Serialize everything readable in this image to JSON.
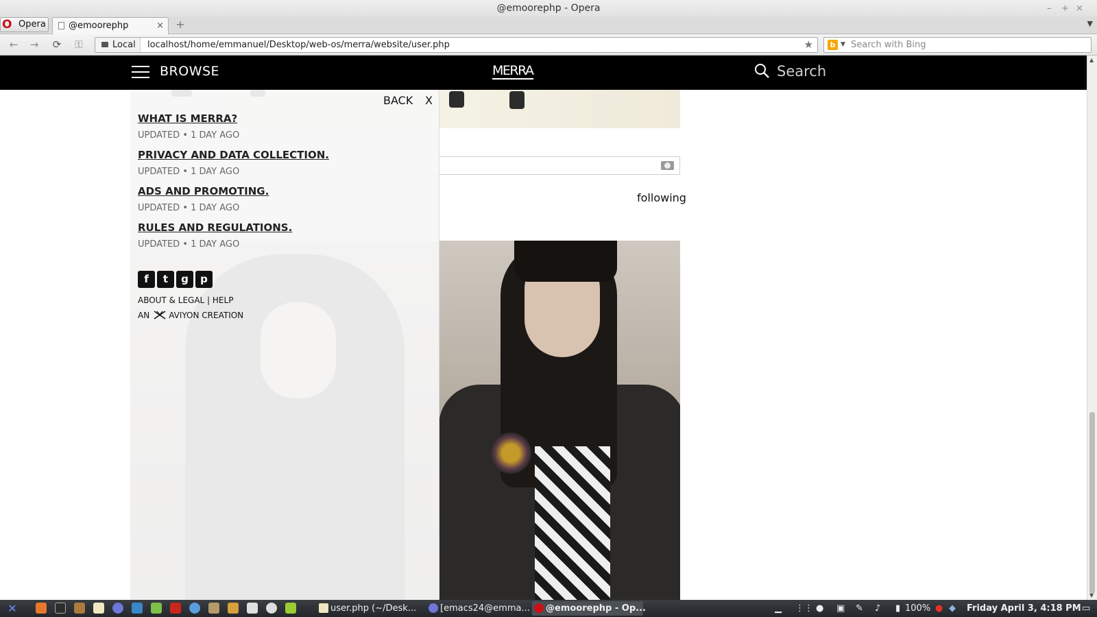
{
  "window": {
    "title": "@emoorephp - Opera",
    "controls": [
      "–",
      "+",
      "×"
    ]
  },
  "browser": {
    "menu_button": "Opera",
    "tab_title": "@emoorephp",
    "tab_close": "×",
    "new_tab": "+",
    "nav_buttons": {
      "back": "←",
      "forward": "→",
      "reload": "⟳",
      "key": "⚿"
    },
    "security_badge": "Local",
    "url": "localhost/home/emmanuel/Desktop/web-os/merra/website/user.php",
    "bookmark_star": "★",
    "search_placeholder": "Search with Bing"
  },
  "site": {
    "header": {
      "browse_label": "BROWSE",
      "logo_text": "MERRA",
      "search_label": "Search"
    },
    "feed": {
      "following_label": "following"
    },
    "menu": {
      "back_label": "BACK",
      "close_label": "X",
      "items": [
        {
          "title": "WHAT IS MERRA?",
          "meta": "UPDATED • 1 DAY AGO"
        },
        {
          "title": "PRIVACY AND DATA COLLECTION.",
          "meta": "UPDATED • 1 DAY AGO"
        },
        {
          "title": "ADS AND PROMOTING.",
          "meta": "UPDATED • 1 DAY AGO"
        },
        {
          "title": "RULES AND REGULATIONS.",
          "meta": "UPDATED • 1 DAY AGO"
        }
      ],
      "social": [
        {
          "name": "facebook-icon",
          "glyph": "f"
        },
        {
          "name": "twitter-icon",
          "glyph": "t"
        },
        {
          "name": "google-plus-icon",
          "glyph": "g"
        },
        {
          "name": "pinterest-icon",
          "glyph": "p"
        }
      ],
      "footer_links": "ABOUT & LEGAL | HELP",
      "credit_prefix": "AN",
      "credit_suffix": "AVIYON CREATION"
    }
  },
  "taskbar": {
    "tasks": [
      {
        "label": "user.php (~/Desk...",
        "active": false
      },
      {
        "label": "[emacs24@emma...",
        "active": false
      },
      {
        "label": "@emoorephp - Op...",
        "active": true
      }
    ],
    "battery": "100%",
    "clock": "Friday April  3,  4:18 PM"
  },
  "colors": {
    "site_header_bg": "#000000",
    "menu_panel_bg": "#f6f6f6",
    "opera_red": "#cc0f16",
    "taskbar_bg": "#2a2d31"
  }
}
